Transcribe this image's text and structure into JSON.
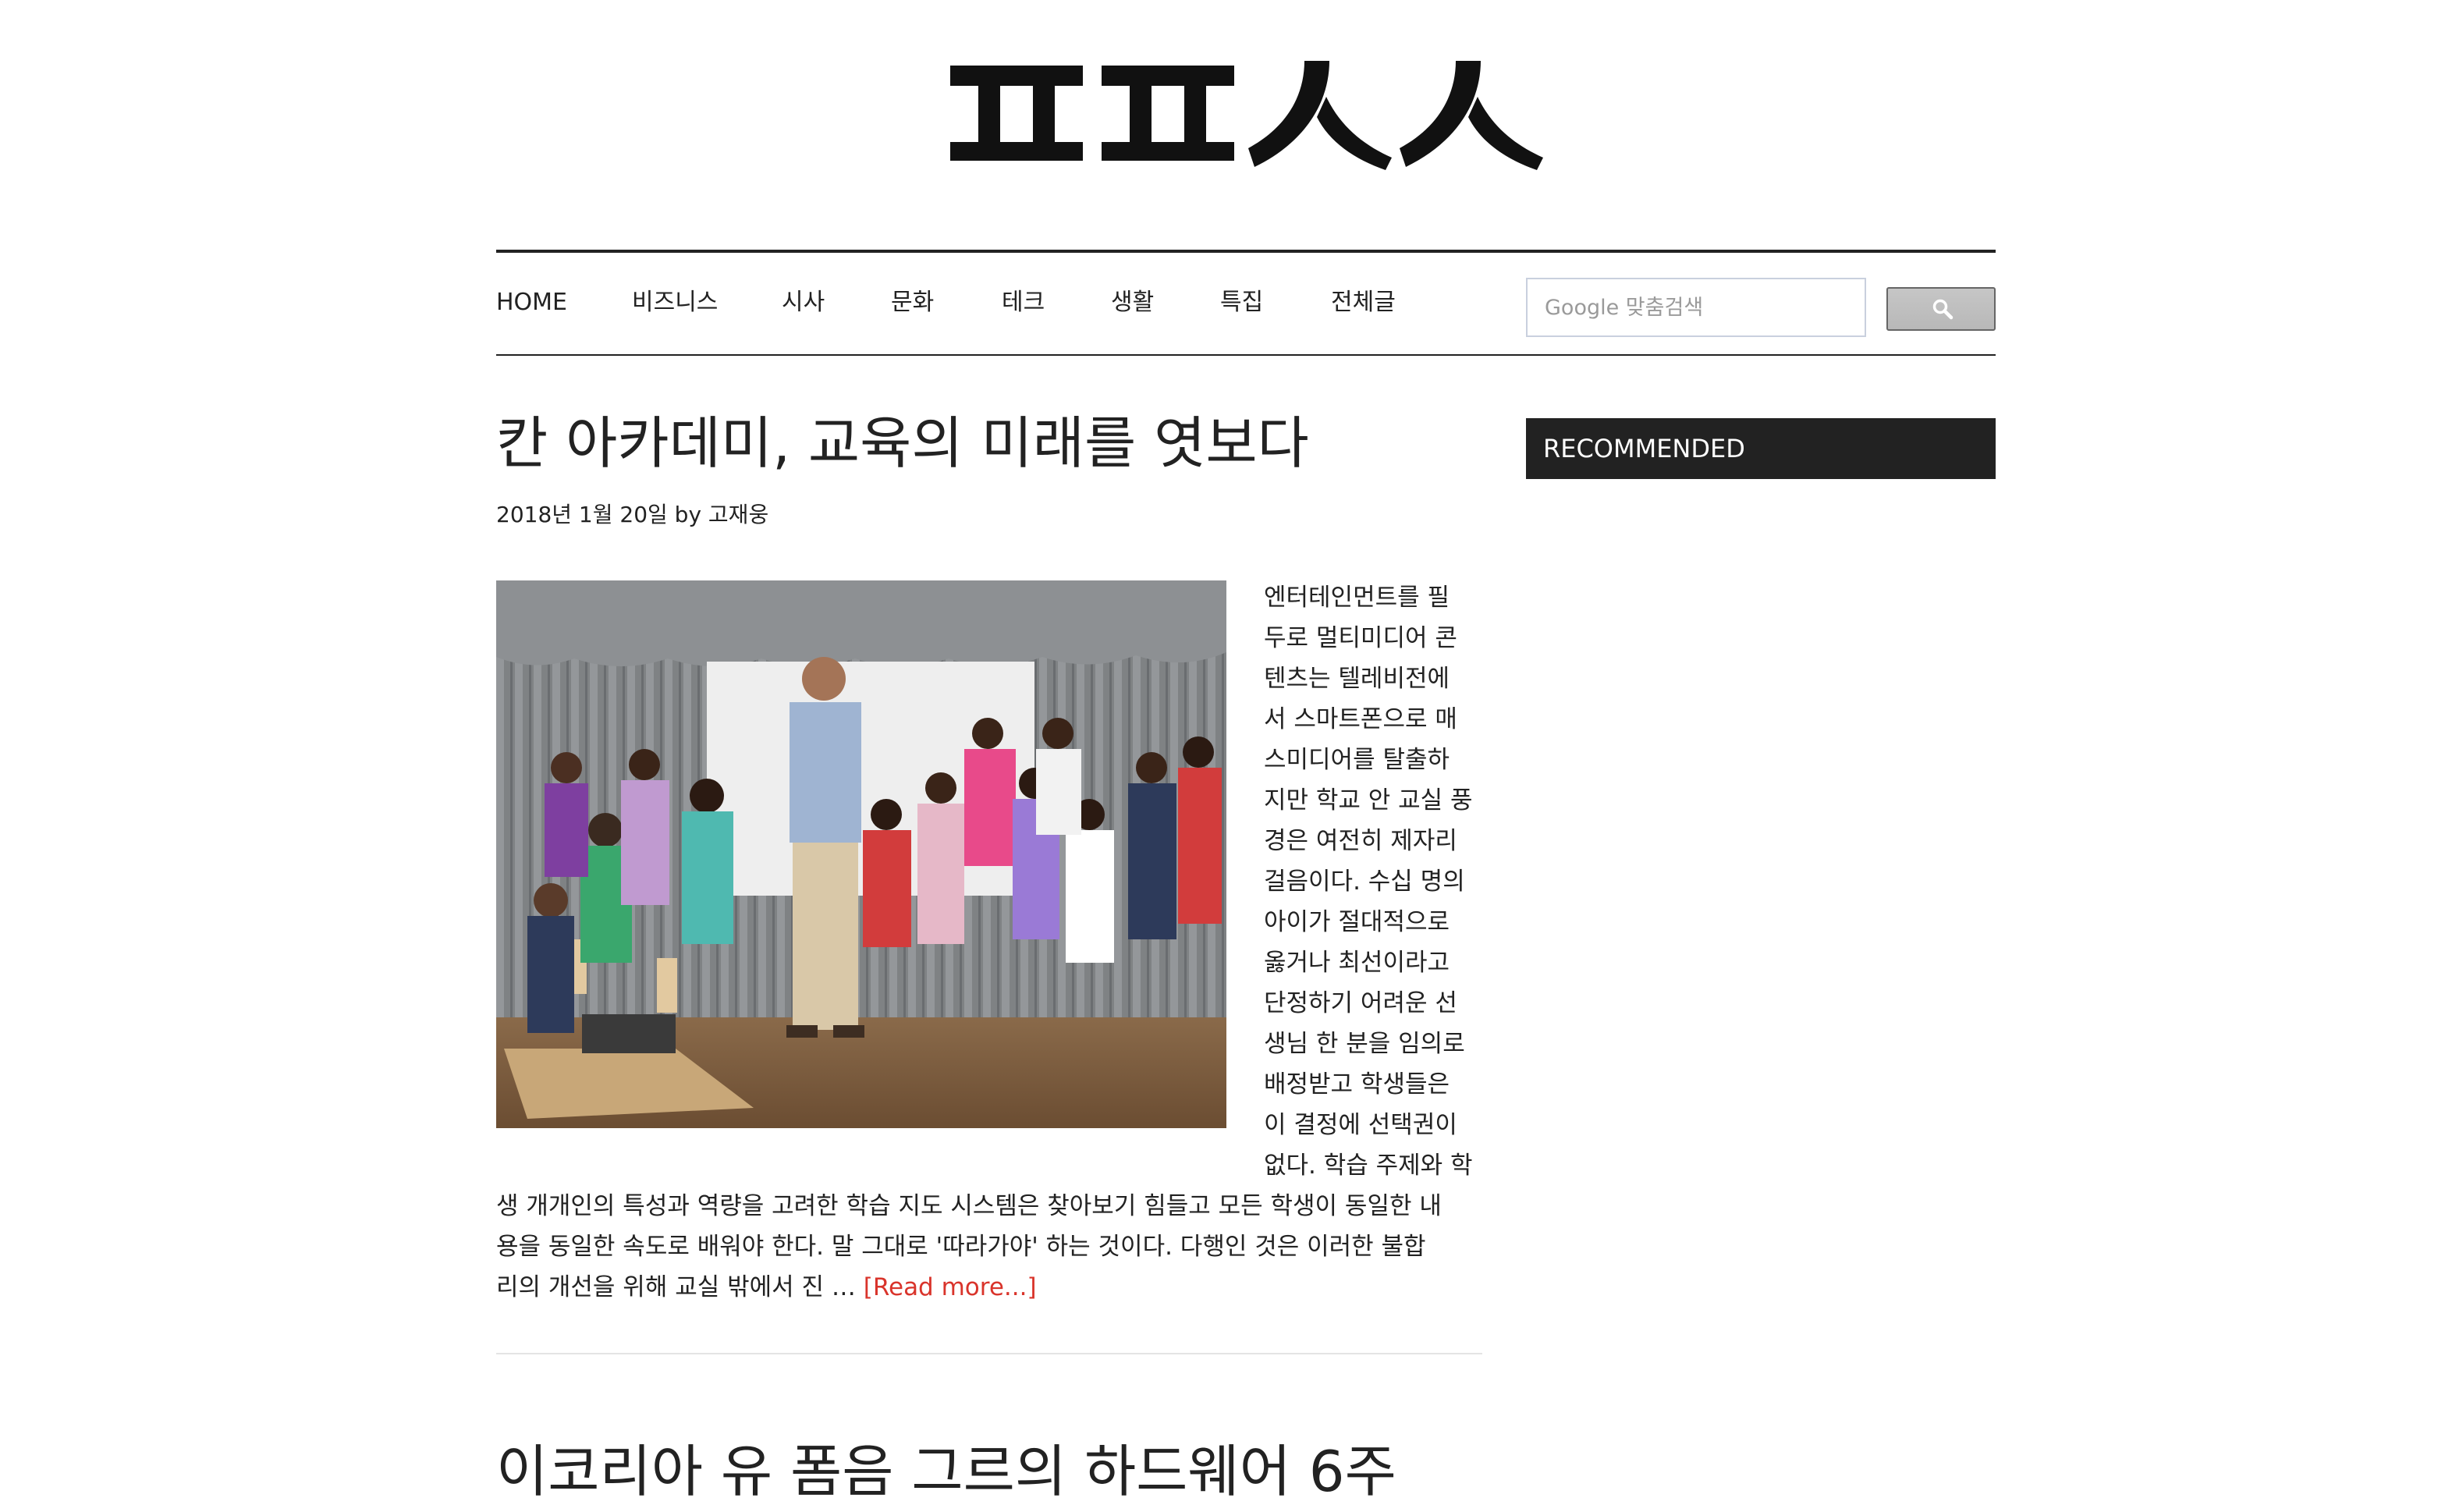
{
  "site": {
    "logo_text": "ㅍㅍㅅㅅ"
  },
  "nav": {
    "items": [
      {
        "label": "HOME"
      },
      {
        "label": "비즈니스"
      },
      {
        "label": "시사"
      },
      {
        "label": "문화"
      },
      {
        "label": "테크"
      },
      {
        "label": "생활"
      },
      {
        "label": "특집"
      },
      {
        "label": "전체글"
      }
    ]
  },
  "search": {
    "placeholder": "Google 맞춤검색",
    "button_icon": "search-icon"
  },
  "article": {
    "title": "칸 아카데미, 교육의 미래를 엿보다",
    "meta": "2018년 1월 20일 by 고재웅",
    "image_alt": "칸 아카데미 교실의 선생님과 아이들",
    "excerpt_narrow_lines": [
      "엔터테인먼트를 필",
      "두로 멀티미디어 콘",
      "텐츠는 텔레비전에",
      "서 스마트폰으로 매",
      "스미디어를 탈출하",
      "지만 학교 안 교실 풍",
      "경은 여전히 제자리",
      "걸음이다. 수십 명의",
      "아이가 절대적으로",
      "옳거나 최선이라고",
      "단정하기 어려운 선",
      "생님 한 분을 임의로",
      "배정받고 학생들은",
      "이 결정에 선택권이",
      "없다. 학습 주제와 학"
    ],
    "excerpt_wide_lines": [
      "생 개개인의 특성과 역량을 고려한 학습 지도 시스템은 찾아보기 힘들고 모든 학생이 동일한 내",
      "용을 동일한 속도로 배워야 한다. 말 그대로 '따라가야' 하는 것이다. 다행인 것은 이러한 불합"
    ],
    "excerpt_last_line": "리의 개선을 위해 교실 밖에서 진 … ",
    "read_more": "[Read more...]"
  },
  "next_article": {
    "title": "이코리아 유 폼음 그르의 하드웨어 6주"
  },
  "sidebar": {
    "widget_title": "RECOMMENDED"
  },
  "colors": {
    "text": "#222222",
    "accent_link": "#d9342b",
    "widget_bg": "#222222",
    "search_border": "#c9d0de"
  }
}
